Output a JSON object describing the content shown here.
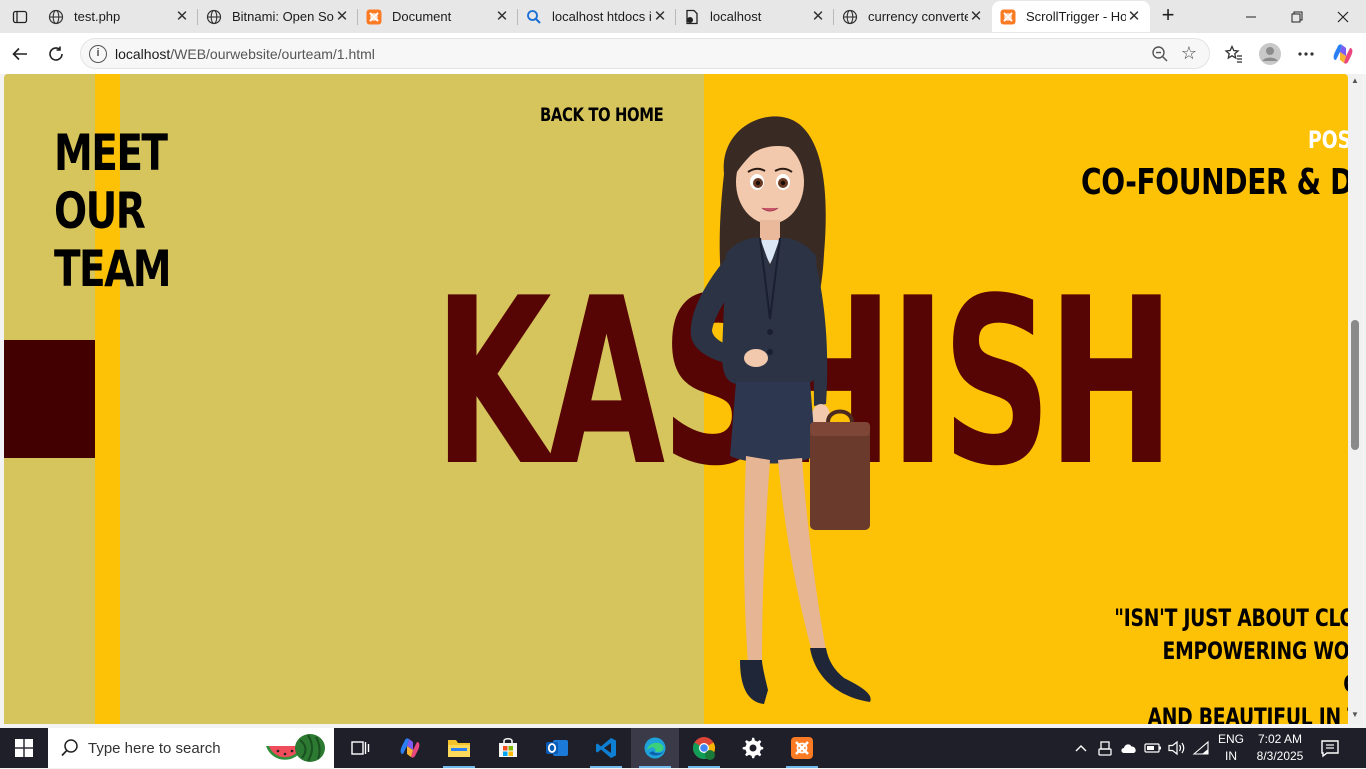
{
  "browser": {
    "tabs": [
      {
        "title": "test.php",
        "favicon": "globe-icon",
        "active": false
      },
      {
        "title": "Bitnami: Open Sou",
        "favicon": "globe-icon",
        "active": false
      },
      {
        "title": "Document",
        "favicon": "xampp-icon",
        "active": false
      },
      {
        "title": "localhost htdocs ir",
        "favicon": "search-icon",
        "active": false
      },
      {
        "title": "localhost",
        "favicon": "page-icon",
        "active": false
      },
      {
        "title": "currency converte",
        "favicon": "globe-icon",
        "active": false
      },
      {
        "title": "ScrollTrigger - Hor",
        "favicon": "xampp-icon",
        "active": true
      }
    ],
    "address": {
      "host": "localhost",
      "path": "/WEB/ourwebsite/ourteam/1.html"
    }
  },
  "page": {
    "heading_lines": [
      "MEET",
      "OUR",
      "TEAM"
    ],
    "back_link": "BACK TO HOME",
    "member_name": "KASHISH",
    "position_label": "POSI",
    "role": "CO-FOUNDER & DEVELO",
    "quote_lines": [
      "\"ISN'T JUST ABOUT CLOTHES—IT'S A",
      "EMPOWERING WOMEN TO FEEL CONFIDENT, E",
      "AND BEAUTIFUL IN THEIR OWN S"
    ],
    "colors": {
      "olive": "#d6c45d",
      "yellow": "#fdc106",
      "maroon": "#560404",
      "dark_block": "#420000"
    }
  },
  "taskbar": {
    "search_placeholder": "Type here to search",
    "language": [
      "ENG",
      "IN"
    ],
    "time": "7:02 AM",
    "date": "8/3/2025"
  }
}
